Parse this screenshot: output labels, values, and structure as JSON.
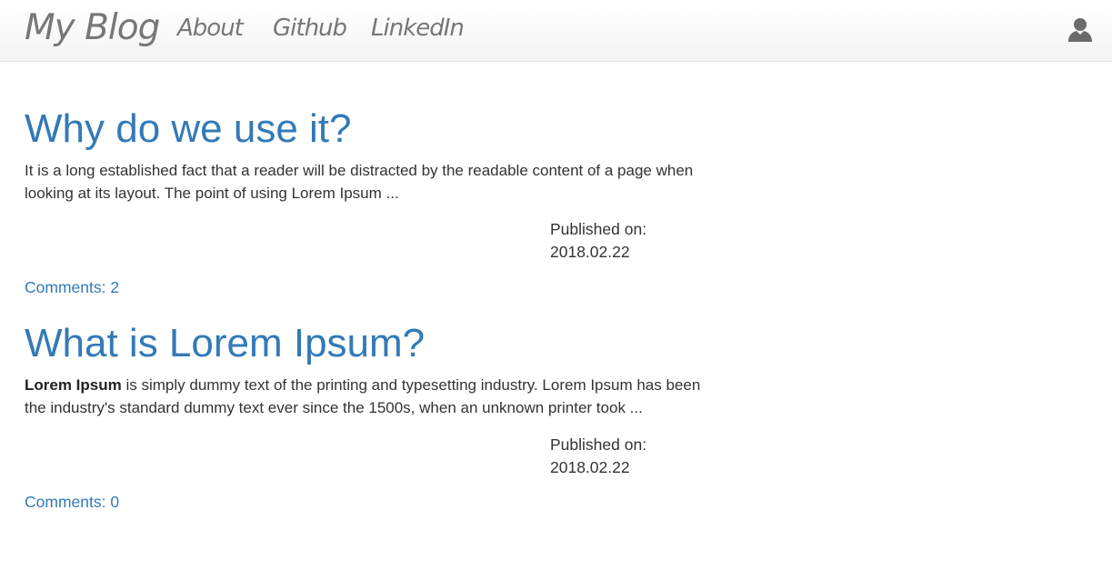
{
  "navbar": {
    "brand": "My Blog",
    "links": [
      {
        "label": "About"
      },
      {
        "label": "Github"
      },
      {
        "label": "LinkedIn"
      }
    ],
    "user_icon": "user-icon"
  },
  "posts": [
    {
      "title": "Why do we use it?",
      "excerpt": "It is a long established fact that a reader will be distracted by the readable content of a page when looking at its layout. The point of using Lorem Ipsum ...",
      "excerpt_bold": "",
      "published_label": "Published on:",
      "published_date": "2018.02.22",
      "comments": "Comments: 2"
    },
    {
      "title": "What is Lorem Ipsum?",
      "excerpt_bold": "Lorem Ipsum",
      "excerpt": " is simply dummy text of the printing and typesetting industry. Lorem Ipsum has been the industry's standard dummy text ever since the 1500s, when an unknown printer took ...",
      "published_label": "Published on:",
      "published_date": "2018.02.22",
      "comments": "Comments: 0"
    }
  ],
  "colors": {
    "link": "#337ab7",
    "text": "#333333",
    "nav_text": "#777777"
  }
}
